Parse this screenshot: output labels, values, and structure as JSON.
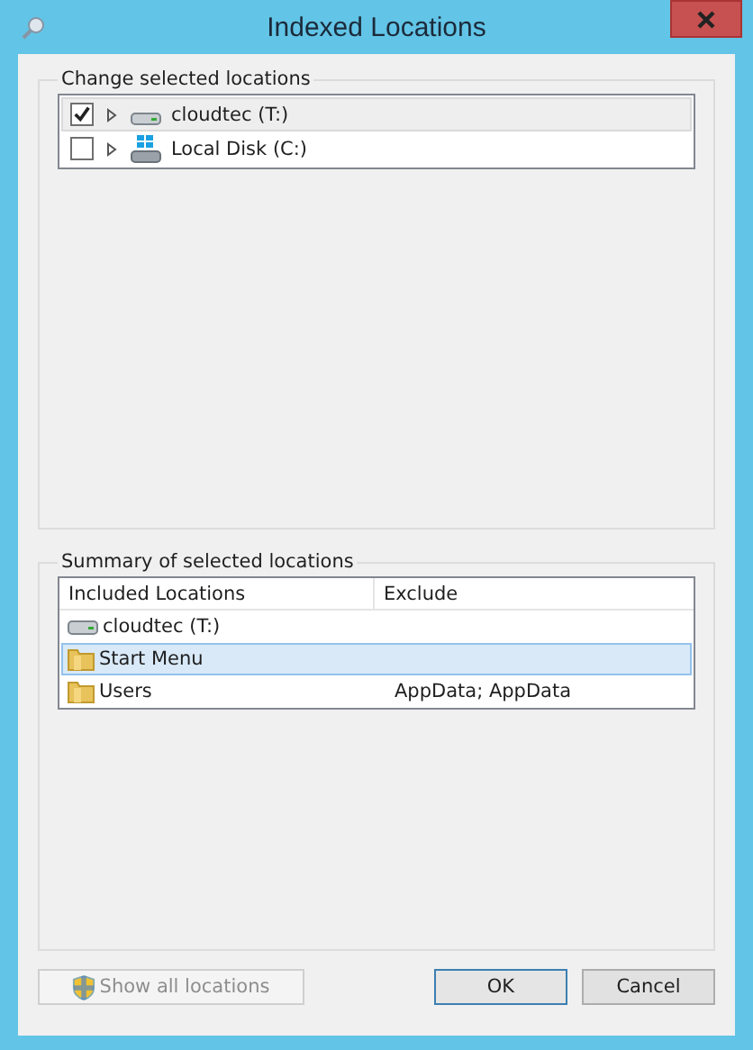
{
  "window": {
    "title": "Indexed Locations"
  },
  "change_group": {
    "title": "Change selected locations",
    "items": [
      {
        "label": "cloudtec (T:)",
        "checked": true,
        "selected": true,
        "kind": "drive"
      },
      {
        "label": "Local Disk (C:)",
        "checked": false,
        "selected": false,
        "kind": "system-drive"
      }
    ]
  },
  "summary_group": {
    "title": "Summary of selected locations",
    "columns": [
      "Included Locations",
      "Exclude"
    ],
    "rows": [
      {
        "location": "cloudtec (T:)",
        "kind": "drive",
        "selected": false
      },
      {
        "location": "Start Menu",
        "kind": "folder",
        "selected": true
      },
      {
        "location": "Users",
        "kind": "folder",
        "exclude": "AppData; AppData",
        "selected": false
      }
    ]
  },
  "buttons": [
    {
      "label": "Show all locations",
      "kind": "shield",
      "disabled": true
    },
    {
      "label": "OK",
      "kind": "default",
      "disabled": false
    },
    {
      "label": "Cancel",
      "kind": "plain",
      "disabled": false
    }
  ]
}
